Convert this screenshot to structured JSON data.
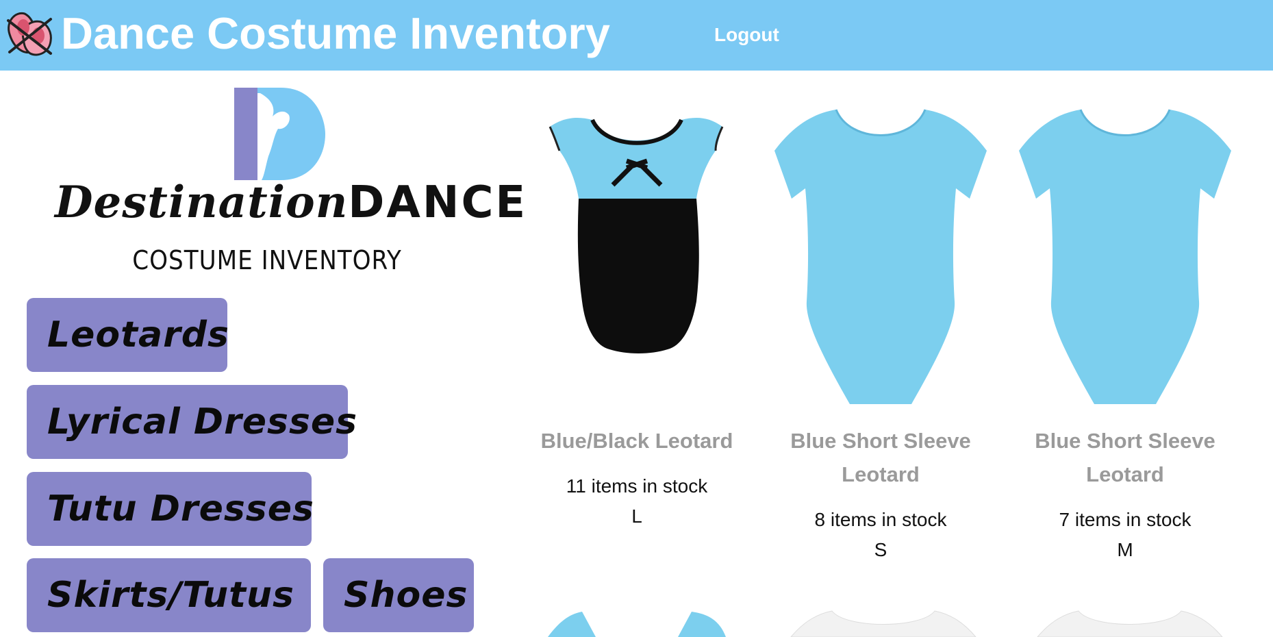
{
  "header": {
    "title": "Dance Costume Inventory",
    "logout_label": "Logout",
    "icon": "ballet-shoes-icon",
    "background_color": "#7bc9f4"
  },
  "logo": {
    "wordmark_script": "Destination",
    "wordmark_caps": "DANCE",
    "subtitle": "COSTUME INVENTORY"
  },
  "categories": [
    {
      "label": "Leotards"
    },
    {
      "label": "Lyrical Dresses"
    },
    {
      "label": "Tutu Dresses"
    },
    {
      "label": "Skirts/Tutus"
    },
    {
      "label": "Shoes"
    }
  ],
  "category_color": "#8886c9",
  "products": [
    {
      "name": "Blue/Black Leotard",
      "stock": "11 items in stock",
      "size": "L",
      "image": "blue-black-leotard-image"
    },
    {
      "name": "Blue Short Sleeve Leotard",
      "stock": "8 items in stock",
      "size": "S",
      "image": "blue-short-sleeve-leotard-image"
    },
    {
      "name": "Blue Short Sleeve Leotard",
      "stock": "7 items in stock",
      "size": "M",
      "image": "blue-short-sleeve-leotard-image"
    }
  ]
}
